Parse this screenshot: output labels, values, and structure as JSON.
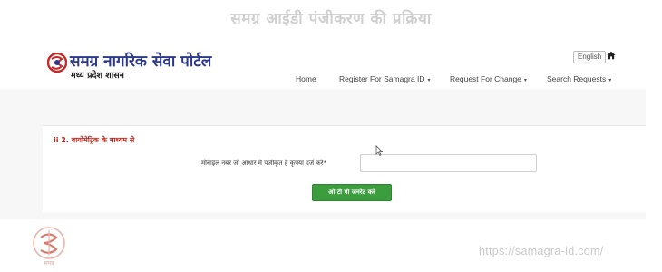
{
  "banner": {
    "title": "समग्र आईडी पंजीकरण की प्रक्रिया"
  },
  "header": {
    "logo_title": "समग्र नागरिक सेवा पोर्टल",
    "logo_subtitle": "मध्य प्रदेश शासन",
    "language_button": "English"
  },
  "nav": {
    "items": [
      {
        "label": "Home",
        "has_caret": false
      },
      {
        "label": "Register For Samagra ID",
        "has_caret": true
      },
      {
        "label": "Request For Change",
        "has_caret": true
      },
      {
        "label": "Search Requests",
        "has_caret": true
      }
    ],
    "caret": "▾"
  },
  "form": {
    "heading": "ii 2. बायोमेट्रिक के माध्यम से",
    "mobile_label": "मोबाइल नंबर जो आधार में पंजीकृत है कृपया दर्ज करें*",
    "mobile_value": "",
    "generate_otp_button": "ओ टी पी जनरेट करें"
  },
  "footer": {
    "url": "https://samagra-id.com/",
    "emblem_caption": "समग्र"
  },
  "colors": {
    "brand_blue": "#2d3a8c",
    "logo_red": "#c62828",
    "heading_red": "#b22a1f",
    "button_green": "#3c9d3f"
  },
  "icons": {
    "logo": "samagra-logo-icon",
    "home": "home-icon",
    "cursor": "mouse-cursor-icon",
    "emblem": "samagra-emblem-icon"
  }
}
